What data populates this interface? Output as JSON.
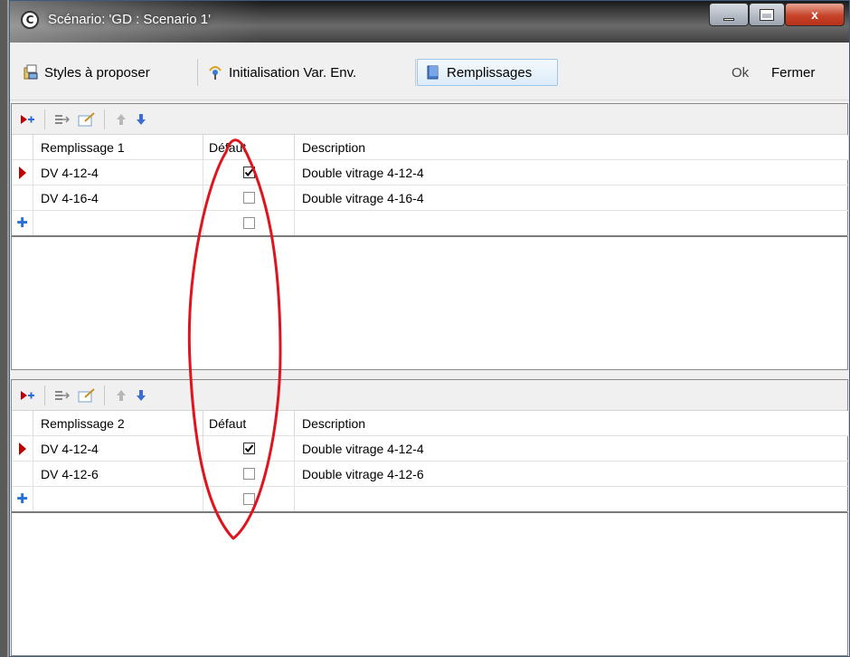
{
  "window": {
    "title": "Scénario: 'GD : Scenario 1'",
    "app_icon_glyph": "C",
    "controls": {
      "close_glyph": "x"
    }
  },
  "toolbar": {
    "styles_label": "Styles à proposer",
    "init_label": "Initialisation Var. Env.",
    "remplissages_label": "Remplissages",
    "ok_label": "Ok",
    "close_label": "Fermer"
  },
  "panels": [
    {
      "header": {
        "name": "Remplissage 1",
        "default": "Défaut",
        "description": "Description"
      },
      "rows": [
        {
          "name": "DV 4-12-4",
          "checked": true,
          "description": "Double vitrage 4-12-4",
          "current": true
        },
        {
          "name": "DV 4-16-4",
          "checked": false,
          "description": "Double vitrage 4-16-4",
          "current": false
        }
      ]
    },
    {
      "header": {
        "name": "Remplissage 2",
        "default": "Défaut",
        "description": "Description"
      },
      "rows": [
        {
          "name": "DV 4-12-4",
          "checked": true,
          "description": "Double vitrage 4-12-4",
          "current": true
        },
        {
          "name": "DV 4-12-6",
          "checked": false,
          "description": "Double vitrage 4-12-6",
          "current": false
        }
      ]
    }
  ],
  "icons": [
    "app-icon",
    "styles-icon",
    "init-icon",
    "remplissages-icon",
    "add-row-icon",
    "insert-icon",
    "edit-icon",
    "move-up-icon",
    "move-down-icon",
    "current-row-indicator-icon",
    "new-row-plus-icon",
    "check-icon"
  ],
  "colors": {
    "annotation_ellipse": "#e0141e",
    "active_tab": "#dcecf9",
    "row_indicator": "#c00000",
    "plus": "#2a6fd6"
  }
}
